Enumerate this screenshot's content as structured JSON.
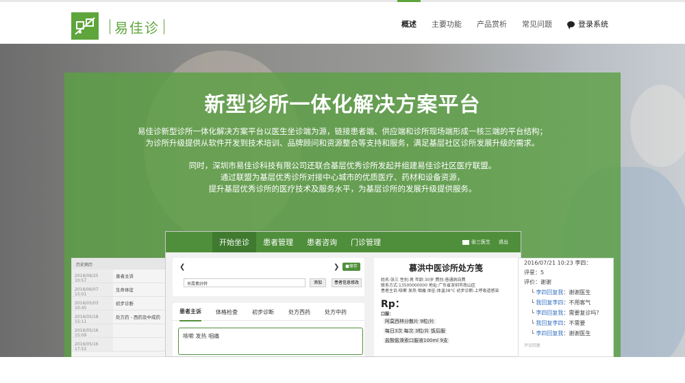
{
  "brand": {
    "name": "易佳诊",
    "color": "#5ea53c"
  },
  "nav": {
    "items": [
      {
        "label": "概述",
        "active": true
      },
      {
        "label": "主要功能",
        "active": false
      },
      {
        "label": "产品赏析",
        "active": false
      },
      {
        "label": "常见问题",
        "active": false
      }
    ],
    "login_label": "登录系统"
  },
  "hero": {
    "title": "新型诊所一体化解决方案平台",
    "para1_line1": "易佳诊新型诊所一体化解决方案平台以医生坐诊端为源，链接患者端、供应端和诊所现场端形成一核三端的平台结构；",
    "para1_line2": "为诊所升级提供从软件开发到技术培训、品牌顾问和资源整合等支持和服务，满足基层社区诊所发展升级的需求。",
    "para2_line1": "同时，深圳市易佳诊科技有限公司还联合基层优秀诊所发起并组建易佳诊社区医疗联盟。",
    "para2_line2": "通过联盟为基层优秀诊所对接中心城市的优质医疗、药材和设备资源，",
    "para2_line3": "提升基层优秀诊所的医疗技术及服务水平，为基层诊所的发展升级提供服务。"
  },
  "left_shot": {
    "header": "历史病历",
    "rows": [
      {
        "date": "2016/06/25 10:57",
        "text": "患者主诉"
      },
      {
        "date": "2016/06/07 15:01",
        "text": "生命体征"
      },
      {
        "date": "2016/05/03 10:45",
        "text": "初步诊断"
      },
      {
        "date": "2016/05/18 15:11",
        "text": "处方药 - 西药及中成药"
      },
      {
        "date": "2016/05/16 15:09",
        "text": ""
      },
      {
        "date": "2016/05/16 17:52",
        "text": ""
      }
    ]
  },
  "app": {
    "tabs": [
      {
        "label": "开始坐诊",
        "active": true
      },
      {
        "label": "患者管理",
        "active": false
      },
      {
        "label": "患者咨询",
        "active": false
      },
      {
        "label": "门诊管理",
        "active": false
      }
    ],
    "user": "张三医生",
    "logout": "退出",
    "save_btn": "■保存",
    "search_value": "肖霞素好转",
    "add_btn": "添加",
    "info_btn": "患者信息修改",
    "record_tabs": [
      "患者主诉",
      "体格检查",
      "初步诊断",
      "处方西药",
      "处方中药"
    ],
    "symptoms": "咳嗽  发热  咽痛"
  },
  "prescription": {
    "title": "慕洪中医诊所处方笺",
    "info1": "姓名:张三    性别:男    年龄:30岁    费别:普通病自费",
    "info2": "联系方式:13500000000    地址:广东省深圳市南山区",
    "info3": "患者主诉:咳嗽 发热 咽痛    体征:体温38°C    初步诊断:上呼吸道感染",
    "rp": "Rp：",
    "kofu": "口服：",
    "drug1": "阿莫西林分散片  9粒/片",
    "drug2": "每日3次 每次 3粒/片  饭后服",
    "drug3": "盐酸氨溴索口服液100ml  9支"
  },
  "right_shot": {
    "line1": "2016/07/21 10:23 李四：",
    "line2": "评星：5",
    "line3": "评价：谢谢",
    "replies": [
      {
        "who": "李四回复我",
        "text": "：谢谢医生"
      },
      {
        "who": "我回复李四",
        "text": "：不用客气"
      },
      {
        "who": "李四回复我",
        "text": "：需要复诊吗？"
      },
      {
        "who": "我回复李四",
        "text": "：不需要"
      },
      {
        "who": "李四回复我",
        "text": "：谢谢医生"
      }
    ],
    "footer": "评论回复"
  }
}
